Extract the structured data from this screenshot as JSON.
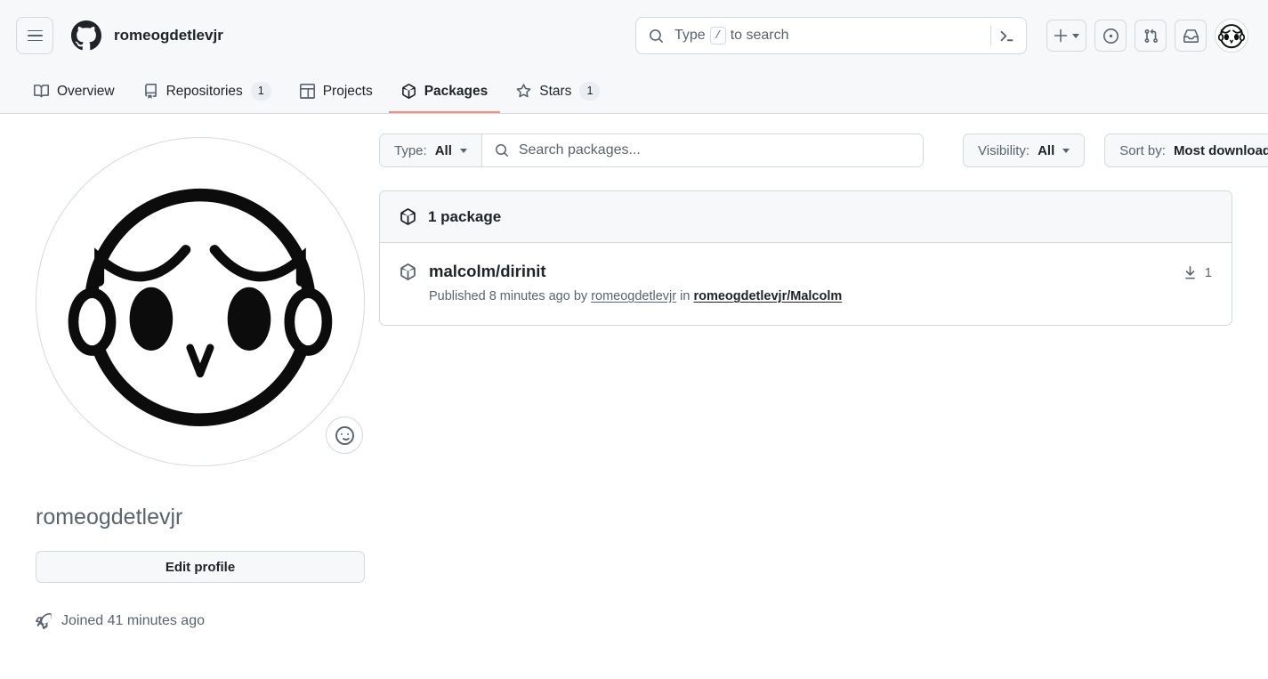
{
  "header": {
    "menu_label": "Open global navigation menu",
    "logo_name": "github-logo",
    "owner": "romeogdetlevjr",
    "search": {
      "prefix": "Type",
      "kbd": "/",
      "suffix": "to search",
      "placeholder": "Type / to search"
    },
    "actions": {
      "create_label": "+",
      "issues_label": "Issues",
      "pull_requests_label": "Pull requests",
      "inbox_label": "Inbox"
    }
  },
  "nav": {
    "tabs": [
      {
        "label": "Overview",
        "icon": "book-icon",
        "count": "",
        "active": false
      },
      {
        "label": "Repositories",
        "icon": "repo-icon",
        "count": "1",
        "active": false
      },
      {
        "label": "Projects",
        "icon": "table-icon",
        "count": "",
        "active": false
      },
      {
        "label": "Packages",
        "icon": "package-icon",
        "count": "",
        "active": true
      },
      {
        "label": "Stars",
        "icon": "star-icon",
        "count": "1",
        "active": false
      }
    ],
    "active_underline_color": "#fd8c73"
  },
  "sidebar": {
    "avatar_name": "user-avatar",
    "status_icon": "smiley-icon",
    "username": "romeogdetlevjr",
    "edit_profile_label": "Edit profile",
    "joined_icon": "rocket-icon",
    "joined_text": "Joined 41 minutes ago"
  },
  "filters": {
    "type_label": "Type:",
    "type_value": "All",
    "search_placeholder": "Search packages...",
    "visibility_label": "Visibility:",
    "visibility_value": "All",
    "sort_label": "Sort by:",
    "sort_value": "Most downloads"
  },
  "packages": {
    "count_label": "1 package",
    "items": [
      {
        "name": "malcolm/dirinit",
        "published_prefix": "Published 8 minutes ago by",
        "author": "romeogdetlevjr",
        "in_word": "in",
        "repository": "romeogdetlevjr/Malcolm",
        "downloads": "1"
      }
    ]
  },
  "colors": {
    "accent_orange": "#fd8c73",
    "surface_gray": "#f6f8fa",
    "border": "#d1d9e0",
    "text_primary": "#1f2328",
    "text_muted": "#59636e"
  }
}
